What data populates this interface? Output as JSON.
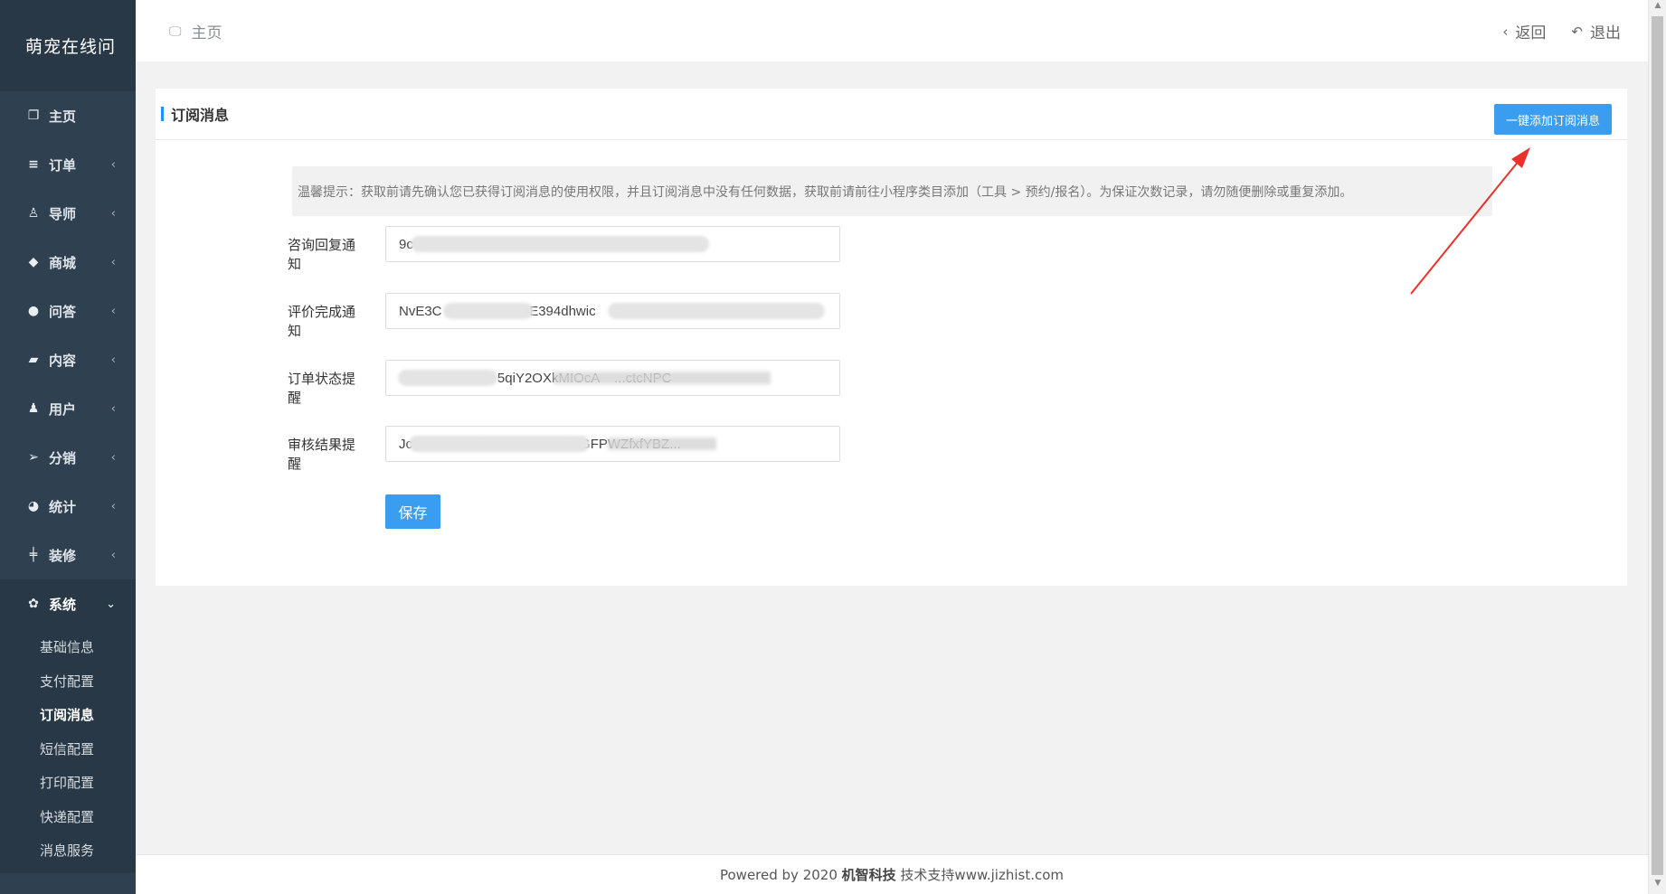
{
  "app": {
    "brand": "萌宠在线问"
  },
  "sidebar": {
    "items": [
      {
        "label": "主页",
        "icon": "copy-icon",
        "glyph": "❐",
        "arrow": ""
      },
      {
        "label": "订单",
        "icon": "list-icon",
        "glyph": "≡",
        "arrow": "‹"
      },
      {
        "label": "导师",
        "icon": "user-outline-icon",
        "glyph": "♙",
        "arrow": "‹"
      },
      {
        "label": "商城",
        "icon": "tags-icon",
        "glyph": "◆",
        "arrow": "‹"
      },
      {
        "label": "问答",
        "icon": "comment-icon",
        "glyph": "●",
        "arrow": "‹"
      },
      {
        "label": "内容",
        "icon": "book-icon",
        "glyph": "▰",
        "arrow": "‹"
      },
      {
        "label": "用户",
        "icon": "user-icon",
        "glyph": "♟",
        "arrow": "‹"
      },
      {
        "label": "分销",
        "icon": "send-icon",
        "glyph": "➢",
        "arrow": "‹"
      },
      {
        "label": "统计",
        "icon": "pie-chart-icon",
        "glyph": "◕",
        "arrow": "‹"
      },
      {
        "label": "装修",
        "icon": "sliders-icon",
        "glyph": "╪",
        "arrow": "‹"
      },
      {
        "label": "系统",
        "icon": "gear-icon",
        "glyph": "✿",
        "arrow": "⌄"
      }
    ],
    "submenu": [
      "基础信息",
      "支付配置",
      "订阅消息",
      "短信配置",
      "打印配置",
      "快递配置",
      "消息服务"
    ]
  },
  "topbar": {
    "crumb": "主页",
    "back": "返回",
    "logout": "退出"
  },
  "card": {
    "title": "订阅消息",
    "add_button": "一键添加订阅消息",
    "notice": "温馨提示：获取前请先确认您已获得订阅消息的使用权限，并且订阅消息中没有任何数据，获取前请前往小程序类目添加（工具 > 预约/报名）。为保证次数记录，请勿随便删除或重复添加。"
  },
  "form": {
    "fields": [
      {
        "label": "咨询回复通知",
        "value": "9c                          ...A-FaZ  1  i1Cl...                  0w"
      },
      {
        "label": "评价完成通知",
        "value": "NvE3C  Md1Wc         E394dhwic            O   OTC"
      },
      {
        "label": "订单状态提醒",
        "value": "  ...J0KJ0T         5qiY2OXkMIOcA    ...ctcNPC"
      },
      {
        "label": "审核结果提醒",
        "value": "Jc                 d25          ...ZEhkGFPWZfxfYBZ..."
      }
    ],
    "save": "保存"
  },
  "footer": {
    "prefix": "Powered by 2020 ",
    "company": "机智科技",
    "suffix": " 技术支持www.jizhist.com"
  },
  "colors": {
    "sidebar": "#2f4050",
    "primary": "#3a9df0",
    "annotation": "#e8322b"
  }
}
